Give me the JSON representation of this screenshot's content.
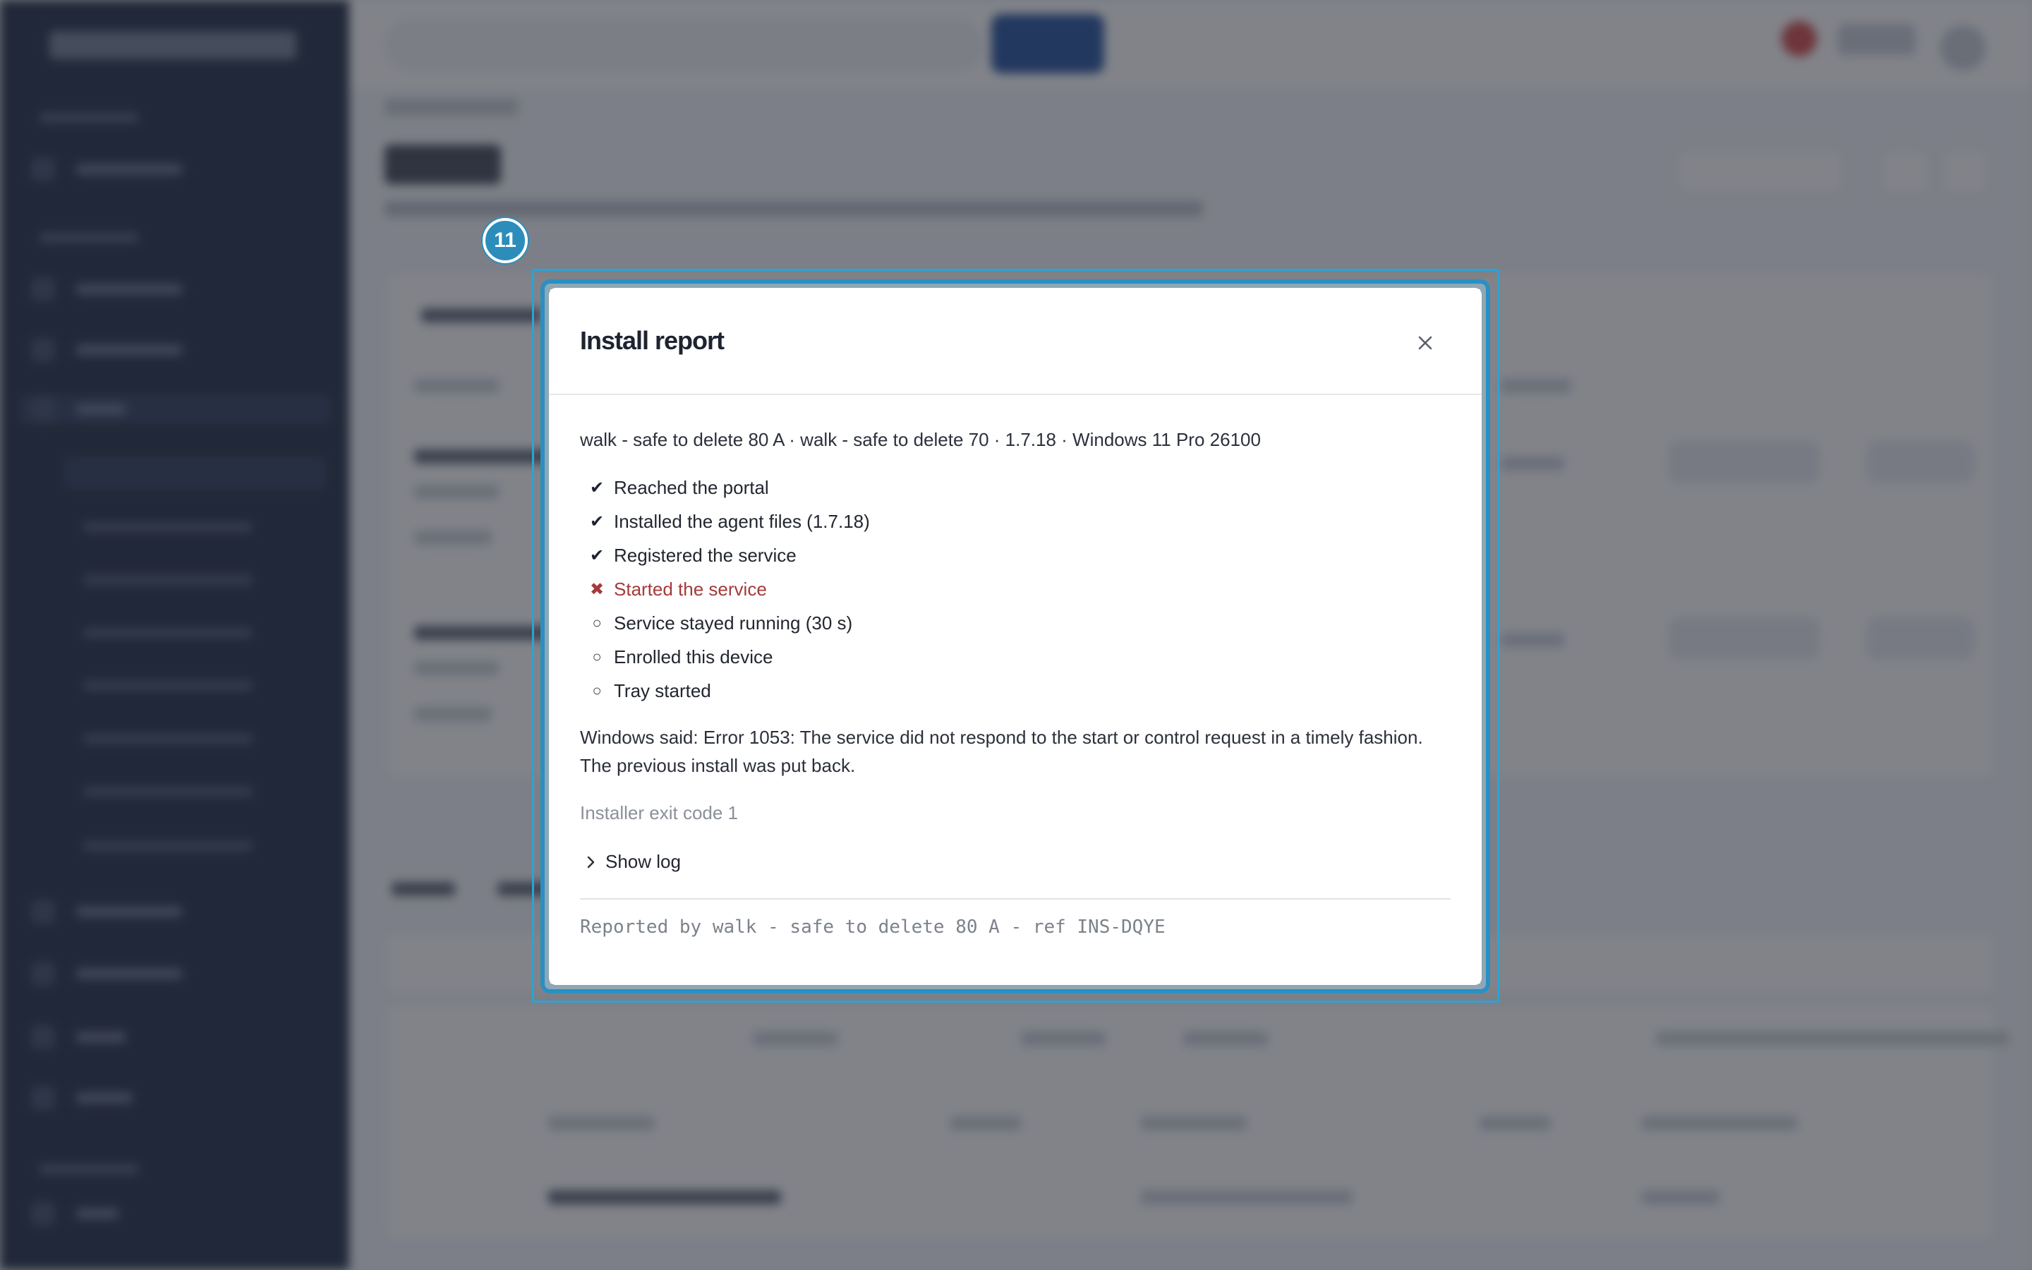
{
  "focus_badge": "11",
  "modal": {
    "title": "Install report",
    "summary": "walk - safe to delete 80 A · walk - safe to delete 70 · 1.7.18 · Windows 11 Pro 26100",
    "steps": [
      {
        "status": "done",
        "icon": "check-icon",
        "glyph": "✔",
        "label": "Reached the portal"
      },
      {
        "status": "done",
        "icon": "check-icon",
        "glyph": "✔",
        "label": "Installed the agent files (1.7.18)"
      },
      {
        "status": "done",
        "icon": "check-icon",
        "glyph": "✔",
        "label": "Registered the service"
      },
      {
        "status": "failed",
        "icon": "cross-icon",
        "glyph": "✖",
        "label": "Started the service"
      },
      {
        "status": "pending",
        "icon": "circle-icon",
        "glyph": "○",
        "label": "Service stayed running (30 s)"
      },
      {
        "status": "pending",
        "icon": "circle-icon",
        "glyph": "○",
        "label": "Enrolled this device"
      },
      {
        "status": "pending",
        "icon": "circle-icon",
        "glyph": "○",
        "label": "Tray started"
      }
    ],
    "windows_message": "Windows said: Error 1053: The service did not respond to the start or control request in a timely fashion. The previous install was put back.",
    "exit_code": "Installer exit code 1",
    "show_log": "Show log",
    "footer_ref": "Reported by walk - safe to delete 80 A - ref INS-DQYE"
  },
  "colors": {
    "accent": "#2890c4",
    "failed": "#a43a3a",
    "sidebar": "#1c2840"
  }
}
